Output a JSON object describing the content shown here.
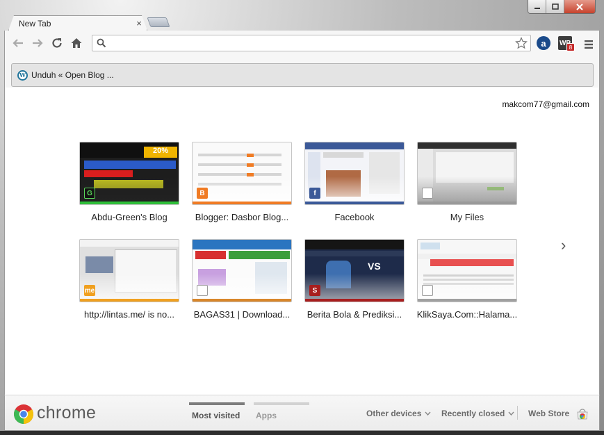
{
  "tab": {
    "title": "New Tab",
    "close": "×"
  },
  "omnibox": {
    "value": "",
    "placeholder": ""
  },
  "extensions": {
    "amazon": "a",
    "wp": "WP",
    "wp_badge": "8"
  },
  "bookmarks": {
    "items": [
      {
        "label": "Unduh « Open Blog ..."
      }
    ]
  },
  "account": {
    "email": "makcom77@gmail.com"
  },
  "most_visited": [
    {
      "label": "Abdu-Green's Blog",
      "bar_color": "#2fbf3a",
      "icon": "abdu-green-icon"
    },
    {
      "label": "Blogger: Dasbor Blog...",
      "bar_color": "#f07b24",
      "icon": "blogger-icon"
    },
    {
      "label": "Facebook",
      "bar_color": "#3b5998",
      "icon": "facebook-icon"
    },
    {
      "label": "My Files",
      "bar_color": "#9a9a9a",
      "icon": "document-icon"
    },
    {
      "label": "http://lintas.me/ is no...",
      "bar_color": "#f0a020",
      "icon": "lintas-icon"
    },
    {
      "label": "BAGAS31 | Download...",
      "bar_color": "#d8862a",
      "icon": "document-icon"
    },
    {
      "label": "Berita Bola & Prediksi...",
      "bar_color": "#a81e1e",
      "icon": "sundul-icon"
    },
    {
      "label": "KlikSaya.Com::Halama...",
      "bar_color": "#a0a0a0",
      "icon": "document-icon"
    }
  ],
  "footer": {
    "wordmark": "chrome",
    "tabs": [
      {
        "label": "Most visited",
        "active": true
      },
      {
        "label": "Apps",
        "active": false
      }
    ],
    "menus": [
      {
        "label": "Other devices"
      },
      {
        "label": "Recently closed"
      }
    ],
    "webstore": "Web Store"
  },
  "nav": {
    "next_arrow": "›"
  }
}
